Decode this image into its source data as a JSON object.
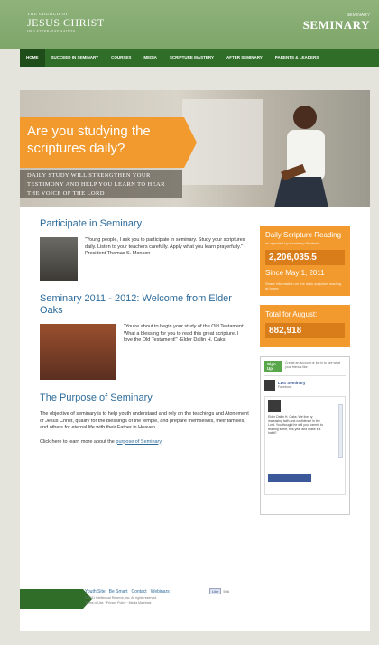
{
  "header": {
    "logo_line1": "THE CHURCH OF",
    "logo_line2": "JESUS CHRIST",
    "logo_line3": "OF LATTER-DAY SAINTS",
    "brand_small": "SEMINARY",
    "brand_large": "SEMINARY"
  },
  "nav": {
    "items": [
      {
        "label": "HOME"
      },
      {
        "label": "SUCCEED IN SEMINARY"
      },
      {
        "label": "COURSES"
      },
      {
        "label": "MEDIA"
      },
      {
        "label": "SCRIPTURE MASTERY"
      },
      {
        "label": "AFTER SEMINARY"
      },
      {
        "label": "PARENTS & LEADERS"
      }
    ]
  },
  "hero": {
    "title": "Are you studying the scriptures daily?",
    "subtitle": "DAILY STUDY WILL STRENGTHEN YOUR TESTIMONY AND HELP YOU LEARN TO HEAR THE VOICE OF THE LORD"
  },
  "main": {
    "section1": {
      "title": "Participate in Seminary",
      "quote": "\"Young people, I ask you to participate in seminary. Study your scriptures daily. Listen to your teachers carefully. Apply what you learn prayerfully.\" -President Thomas S. Monson"
    },
    "section2": {
      "title": "Seminary 2011 - 2012: Welcome from Elder Oaks",
      "quote": "\"You're about to begin your study of the Old Testament. What a blessing for you to read this great scripture. I love the Old Testament!\" -Elder Dallin H. Oaks"
    },
    "section3": {
      "title": "The Purpose of Seminary",
      "para": "The objective of seminary is to help youth understand and rely on the teachings and Atonement of Jesus Christ, qualify for the blessings of the temple, and prepare themselves, their families, and others for eternal life with their Father in Heaven.",
      "click_prefix": "Click here to learn more about the ",
      "click_link": "purpose of Seminary",
      "click_suffix": "."
    }
  },
  "sidebar": {
    "scripture": {
      "title": "Daily Scripture Reading",
      "small": "as reported by Seminary Students",
      "count": "2,206,035.5",
      "since": "Since May 1, 2011",
      "note": "Share information on the daily scripture reading at home."
    },
    "august": {
      "title": "Total for August:",
      "count": "882,918"
    },
    "facebook": {
      "signup": "Sign Up",
      "signup_note": "Create an account or log in to see what your friends like.",
      "page_name": "LDS Seminary",
      "page_sub": "Facebook",
      "post_text": "Elder Dallin H. Oaks: We live by increasing faith and confidence in the Lord. You thought he will you commit to reading some, this year and make it a habit?"
    }
  },
  "footer": {
    "links": [
      "Youth Site",
      "Be Smart",
      "Contact",
      "Webinars"
    ],
    "like": "Like",
    "like_count": "506",
    "copyright": "© 2011 Intellectual Reserve, Inc. All rights reserved.",
    "legal": "Terms of Use · Privacy Policy · Media Materials"
  }
}
